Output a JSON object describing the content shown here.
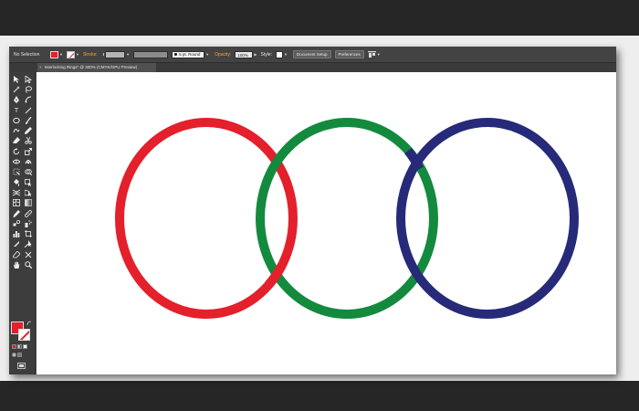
{
  "control_bar": {
    "selection_state": "No Selection",
    "stroke_label": "Stroke:",
    "brush": "5 pt. Round",
    "opacity_label": "Opacity:",
    "opacity_value": "100%",
    "style_label": "Style:",
    "document_setup_button": "Document Setup",
    "preferences_button": "Preferences"
  },
  "document_tab": {
    "close_glyph": "×",
    "title": "Interlocking Rings* @ 300% (CMYK/GPU Preview)"
  },
  "toolbar": {
    "tools": [
      "selection-tool-icon",
      "direct-selection-tool-icon",
      "magic-wand-tool-icon",
      "lasso-tool-icon",
      "pen-tool-icon",
      "curvature-tool-icon",
      "type-tool-icon",
      "line-segment-tool-icon",
      "ellipse-tool-icon",
      "paintbrush-tool-icon",
      "shaper-tool-icon",
      "pencil-tool-icon",
      "eraser-tool-icon",
      "scissors-tool-icon",
      "rotate-tool-icon",
      "scale-tool-icon",
      "width-tool-icon",
      "warp-tool-icon",
      "free-transform-tool-icon",
      "shape-builder-tool-icon",
      "live-paint-tool-icon",
      "live-paint-selection-icon",
      "perspective-grid-tool-icon",
      "perspective-selection-icon",
      "mesh-tool-icon",
      "gradient-tool-icon",
      "eyedropper-tool-icon",
      "measure-tool-icon",
      "blend-tool-icon",
      "symbol-sprayer-tool-icon",
      "column-graph-tool-icon",
      "artboard-tool-icon",
      "slice-tool-icon",
      "slice-selection-icon",
      "eraser-alt-tool-icon",
      "scissors-alt-tool-icon",
      "hand-tool-icon",
      "zoom-tool-icon"
    ]
  },
  "colors": {
    "fill": "#e3202b",
    "stroke": "#ffffff",
    "ring_red": "#e3202b",
    "ring_green": "#138a3d",
    "ring_blue": "#262a78",
    "accent_label": "#f7a43a"
  },
  "canvas": {
    "rings": [
      {
        "name": "red-ring",
        "color": "#e3202b"
      },
      {
        "name": "green-ring",
        "color": "#138a3d"
      },
      {
        "name": "blue-ring",
        "color": "#262a78"
      }
    ]
  }
}
